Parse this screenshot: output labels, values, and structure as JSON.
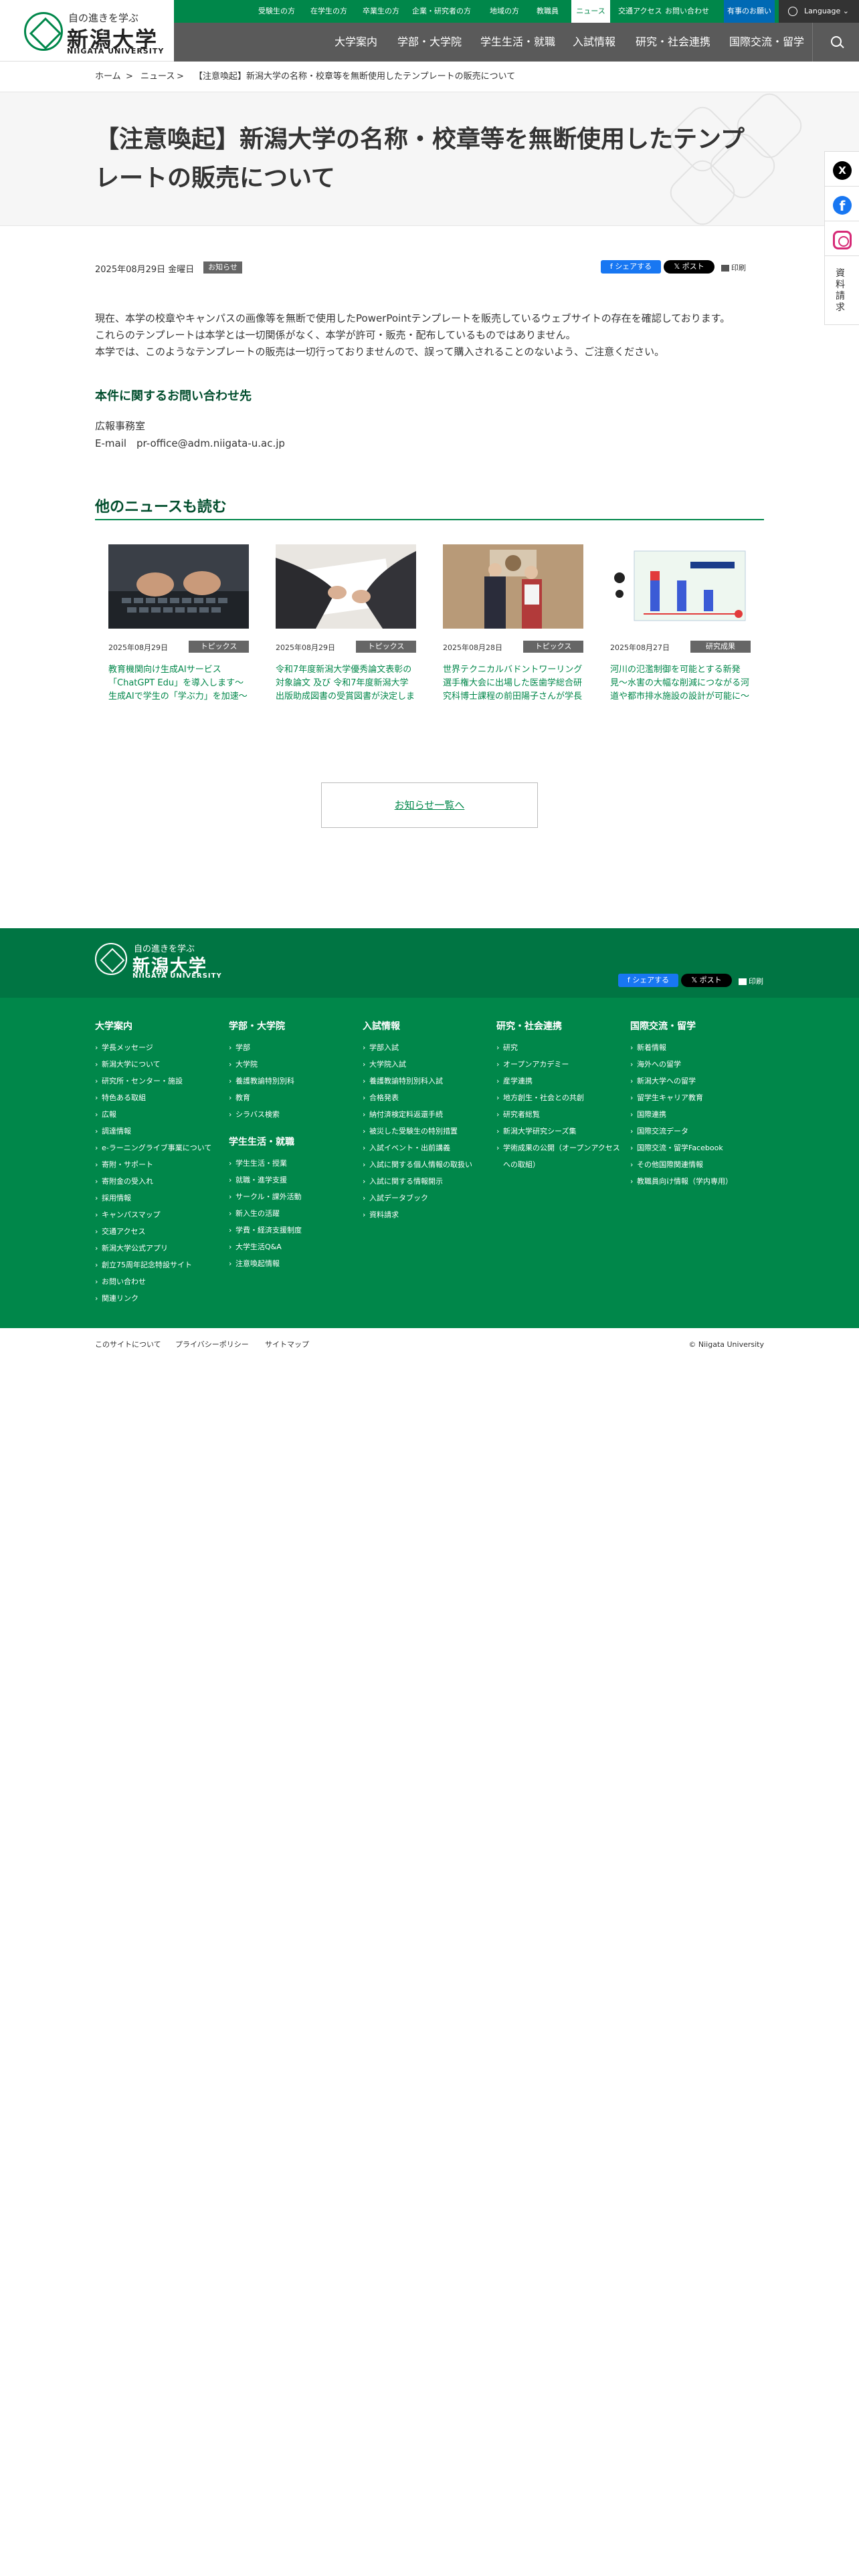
{
  "header": {
    "logo_sub": "自の進きを学ぶ",
    "logo_main": "新潟大学",
    "logo_en": "NIIGATA UNIVERSITY",
    "topbar": [
      "受験生の方",
      "在学生の方",
      "卒業生の方",
      "企業・研究者の方",
      "地域の方",
      "教職員",
      "ニュース",
      "交通アクセス",
      "お問い合わせ",
      "有事のお願い",
      "Language"
    ],
    "nav": [
      "大学案内",
      "学部・大学院",
      "学生生活・就職",
      "入試情報",
      "研究・社会連携",
      "国際交流・留学"
    ]
  },
  "breadcrumb": [
    "ホーム",
    ">",
    "ニュース",
    ">",
    "【注意喚起】新潟大学の名称・校章等を無断使用したテンプレートの販売について"
  ],
  "article": {
    "title": "【注意喚起】新潟大学の名称・校章等を無断使用したテンプレートの販売について",
    "date": "2025年08月29日 金曜日",
    "category": "お知らせ",
    "share_fb": "シェアする",
    "share_x": "ポスト",
    "print": "印刷",
    "body": [
      "現在、本学の校章やキャンパスの画像等を無断で使用したPowerPointテンプレートを販売しているウェブサイトの存在を確認しております。",
      "これらのテンプレートは本学とは一切関係がなく、本学が許可・販売・配布しているものではありません。",
      "本学では、このようなテンプレートの販売は一切行っておりませんので、誤って購入されることのないよう、ご注意ください。"
    ],
    "inquiry_heading": "本件に関するお問い合わせ先",
    "inquiry_dept": "広報事務室",
    "inquiry_email": "E-mail　pr-office@adm.niigata-u.ac.jp"
  },
  "side": {
    "x": "X",
    "facebook": "f",
    "doc_request": "資料請求"
  },
  "other_news": {
    "heading": "他のニュースも読む",
    "cards": [
      {
        "date": "2025年08月29日",
        "badge": "トピックス",
        "title": "教育機関向け生成AIサービス「ChatGPT Edu」を導入します〜生成AIで学生の「学ぶ力」を加速〜"
      },
      {
        "date": "2025年08月29日",
        "badge": "トピックス",
        "title": "令和7年度新潟大学優秀論文表彰の対象論文 及び 令和7年度新潟大学出版助成図書の受賞図書が決定しました"
      },
      {
        "date": "2025年08月28日",
        "badge": "トピックス",
        "title": "世界テクニカルバドントワーリング選手権大会に出場した医歯学総合研究科博士課程の前田陽子さんが学長に報告を行いました"
      },
      {
        "date": "2025年08月27日",
        "badge": "研究成果",
        "title": "河川の氾濫制御を可能とする新発見〜水害の大幅な削減につながる河道や都市排水施設の設計が可能に〜"
      }
    ],
    "list_button": "お知らせ一覧へ"
  },
  "footer": {
    "logo_sub": "自の進きを学ぶ",
    "logo_main": "新潟大学",
    "logo_en": "NIIGATA UNIVERSITY",
    "share_fb": "シェアする",
    "share_x": "ポスト",
    "print": "印刷",
    "col1": {
      "heading": "大学案内",
      "items": [
        "学長メッセージ",
        "新潟大学について",
        "研究所・センター・施設",
        "特色ある取組",
        "広報",
        "調達情報",
        "e-ラーニングライブ事業について",
        "寄附・サポート",
        "寄附金の受入れ",
        "採用情報",
        "キャンパスマップ",
        "交通アクセス",
        "新潟大学公式アプリ",
        "創立75周年記念特設サイト",
        "お問い合わせ",
        "関連リンク"
      ]
    },
    "col2": {
      "heading": "学部・大学院",
      "items": [
        "学部",
        "大学院",
        "養護教諭特別別科",
        "教育",
        "シラバス検索"
      ]
    },
    "col2b": {
      "heading": "学生生活・就職",
      "items": [
        "学生生活・授業",
        "就職・進学支援",
        "サークル・課外活動",
        "新入生の活躍",
        "学費・経済支援制度",
        "大学生活Q&A",
        "注意喚起情報"
      ]
    },
    "col3": {
      "heading": "入試情報",
      "items": [
        "学部入試",
        "大学院入試",
        "養護教諭特別別科入試",
        "合格発表",
        "納付済検定料返還手続",
        "被災した受験生の特別措置",
        "入試イベント・出前講義",
        "入試に関する個人情報の取扱い",
        "入試に関する情報開示",
        "入試データブック",
        "資料請求"
      ]
    },
    "col4": {
      "heading": "研究・社会連携",
      "items": [
        "研究",
        "オープンアカデミー",
        "産学連携",
        "地方創生・社会との共創",
        "研究者総覧",
        "新潟大学研究シーズ集",
        "学術成果の公開（オープンアクセスへの取組）"
      ]
    },
    "col5": {
      "heading": "国際交流・留学",
      "items": [
        "新着情報",
        "海外への留学",
        "新潟大学への留学",
        "留学生キャリア教育",
        "国際連携",
        "国際交流データ",
        "国際交流・留学Facebook",
        "その他国際関連情報",
        "教職員向け情報（学内専用）"
      ]
    },
    "bottom": [
      "このサイトについて",
      "プライバシーポリシー",
      "サイトマップ"
    ],
    "copyright": "© Niigata University"
  }
}
